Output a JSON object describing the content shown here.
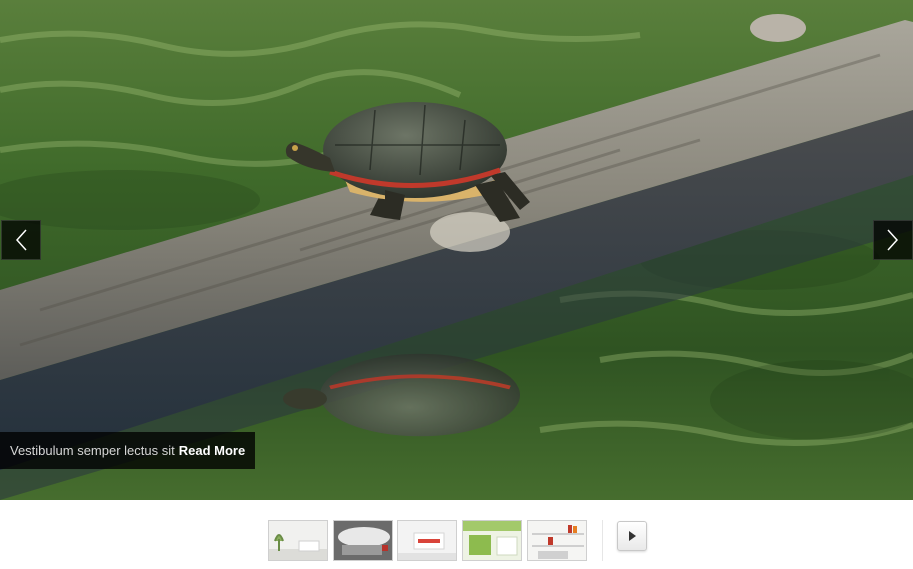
{
  "slider": {
    "image": "painted turtle basking on a log over green water",
    "prev_icon": "chevron-left-icon",
    "next_icon": "chevron-right-icon"
  },
  "caption": {
    "text": "Vestibulum semper lectus sit",
    "link_label": "Read More"
  },
  "thumbnails": [
    "white living room with chair and plant",
    "grey room with sofa and red accent",
    "white room with red lit shelf",
    "green and white kitchen",
    "white shelving with red books"
  ],
  "controls": {
    "play_icon": "play-icon"
  },
  "colors": {
    "water_green": "#3f6a2a",
    "overlay": "#000000",
    "caption_link": "#ffffff"
  }
}
